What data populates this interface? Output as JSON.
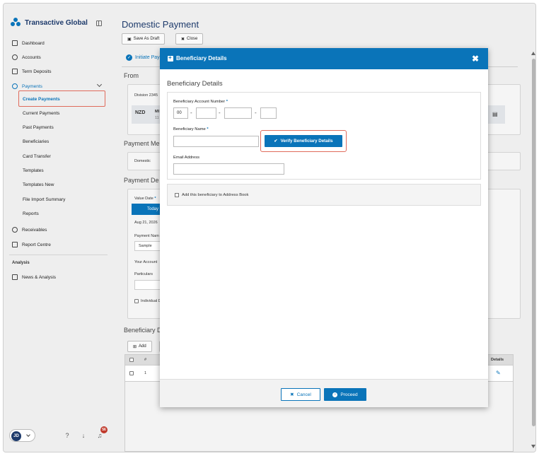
{
  "brand": {
    "title": "Transactive Global"
  },
  "sidebar": {
    "items": [
      {
        "label": "Dashboard"
      },
      {
        "label": "Accounts"
      },
      {
        "label": "Term Deposits"
      },
      {
        "label": "Payments"
      }
    ],
    "payments_sub": [
      {
        "label": "Create Payments"
      },
      {
        "label": "Current Payments"
      },
      {
        "label": "Past Payments"
      },
      {
        "label": "Beneficiaries"
      },
      {
        "label": "Card Transfer"
      },
      {
        "label": "Templates"
      },
      {
        "label": "Templates New"
      },
      {
        "label": "File Import Summary"
      },
      {
        "label": "Reports"
      }
    ],
    "lower_items": [
      {
        "label": "Receivables"
      },
      {
        "label": "Report Centre"
      }
    ],
    "analysis_section": "Analysis",
    "analysis_items": [
      {
        "label": "News & Analysis"
      }
    ],
    "user_initials": "JD",
    "notification_count": "56"
  },
  "page": {
    "title": "Domestic Payment",
    "save_draft": "Save As Draft",
    "close": "Close",
    "tab_active": "Initiate Pay",
    "from_title": "From",
    "division_label": "Division",
    "division_value": "2345",
    "currency": "NZD",
    "account_code": "MI",
    "account_number": "11",
    "payment_method_title": "Payment Me",
    "payment_method_value": "Domestic",
    "payment_details_title": "Payment De",
    "value_date_label": "Value Date",
    "today_label": "Today",
    "date_value": "Aug 21, 2026",
    "payment_name_label": "Payment Nam",
    "payment_name_value": "Sample",
    "your_account_label": "Your Account",
    "particulars_label": "Particulars",
    "individual_label": "Individual D",
    "beneficiary_title": "Beneficiary D",
    "add_label": "Add",
    "grid_hash": "#",
    "grid_details": "Details",
    "row_number": "1"
  },
  "modal": {
    "header_title": "Beneficiary Details",
    "subtitle": "Beneficiary Details",
    "account_number_label": "Beneficiary Account Number",
    "account_prefix": "00",
    "name_label": "Beneficiary Name",
    "verify_button": "Verify Beneficiary Details",
    "email_label": "Email Address",
    "address_book_label": "Add this beneficiary to Address Book",
    "cancel_button": "Cancel",
    "proceed_button": "Proceed"
  },
  "colors": {
    "accent": "#0a74b9",
    "highlight": "#e06b5c",
    "badge": "#c0392b"
  }
}
